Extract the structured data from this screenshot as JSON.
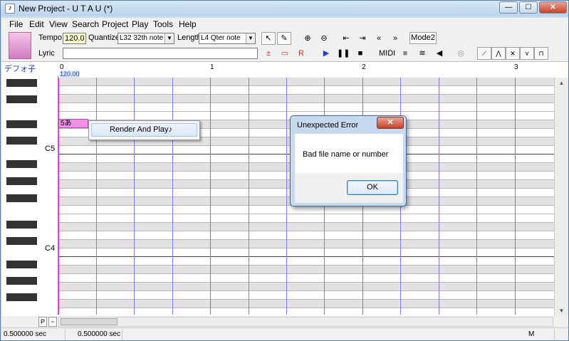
{
  "window": {
    "title": "New Project - U T A U (*)",
    "minimize": "—",
    "maximize": "☐",
    "close": "✕"
  },
  "menu": [
    "File",
    "Edit",
    "View",
    "Search",
    "Project",
    "Play",
    "Tools",
    "Help"
  ],
  "toolbar": {
    "tempo_label": "Tempo",
    "tempo_value": "120.0",
    "quantize_label": "Quantize",
    "quantize_value": "L32 32th note",
    "length_label": "Length",
    "length_value": "L4  Qter note",
    "lyric_label": "Lyric",
    "lyric_value": "",
    "mode2_label": "Mode2",
    "midi_label": "MIDI",
    "icons": [
      "pointer-icon",
      "pencil-icon",
      "zoom-in-icon",
      "zoom-out-icon",
      "skip-start-icon",
      "skip-end-icon",
      "step-back-icon",
      "step-forward-icon",
      "insert-note-icon",
      "delete-note-icon",
      "insert-rest-icon",
      "play-icon",
      "pause-icon",
      "stop-icon",
      "record-icon",
      "settings-icon",
      "speaker-icon",
      "loop-icon",
      "envelope-1-icon",
      "envelope-2-icon",
      "envelope-3-icon",
      "envelope-4-icon",
      "envelope-5-icon"
    ]
  },
  "editor": {
    "singer_name": "デフォ子",
    "tempo_marker": "120.00",
    "measures": [
      "0",
      "1",
      "2",
      "3"
    ],
    "key_labels": {
      "c5": "C5",
      "c4": "C4"
    },
    "note": {
      "lyric": "5あ"
    }
  },
  "bottom": {
    "p_button": "P",
    "tilde_button": "~"
  },
  "status": {
    "left_time": "0.500000 sec",
    "right_time": "0.500000 sec",
    "mode": "M"
  },
  "context_menu": {
    "item": "Render And Play♪"
  },
  "dialog": {
    "title": "Unexpected Error",
    "close": "✕",
    "message": "Bad file name or number",
    "ok_label": "OK"
  }
}
